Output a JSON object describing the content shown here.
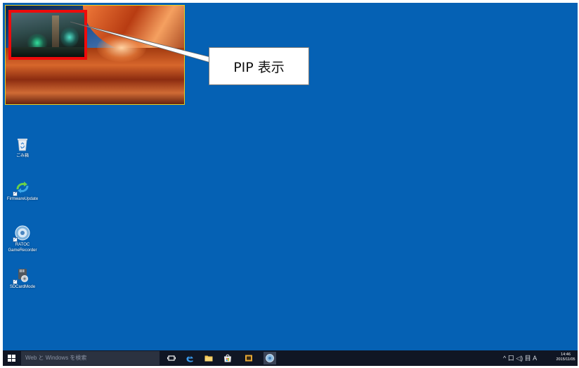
{
  "callout": {
    "text": "PIP 表示"
  },
  "desktop_icons": [
    {
      "label": "ごみ箱",
      "icon": "recycle-bin-icon"
    },
    {
      "label": "FirmwareUpdate",
      "icon": "firmware-update-icon"
    },
    {
      "label": "RATOC GameRecorder",
      "icon": "game-recorder-icon"
    },
    {
      "label": "SDCardMode",
      "icon": "sd-card-mode-icon"
    }
  ],
  "taskbar": {
    "search_placeholder": "Web と Windows を検索",
    "tray_text": "^ 口 ◁) 目 A",
    "time": "14:46",
    "date": "2015/11/05"
  },
  "colors": {
    "desktop": "#0561b4",
    "pip_border": "#ee0b0b",
    "preview_border": "#e8d020",
    "taskbar": "#101624"
  }
}
